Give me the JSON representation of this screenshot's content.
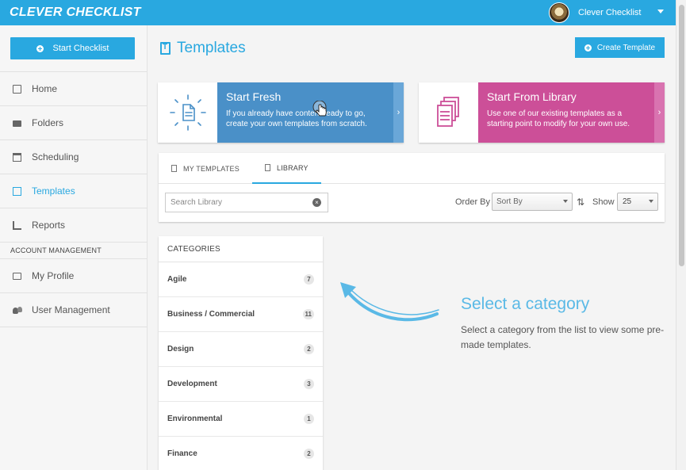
{
  "app": {
    "logo": "CLEVER CHECKLIST",
    "user_name": "Clever Checklist"
  },
  "sidebar": {
    "start_button": "Start Checklist",
    "items": [
      {
        "label": "Home",
        "icon": "document-icon"
      },
      {
        "label": "Folders",
        "icon": "folder-icon"
      },
      {
        "label": "Scheduling",
        "icon": "calendar-icon"
      },
      {
        "label": "Templates",
        "icon": "template-icon",
        "active": true
      },
      {
        "label": "Reports",
        "icon": "chart-icon"
      }
    ],
    "section_label": "ACCOUNT MANAGEMENT",
    "account_items": [
      {
        "label": "My Profile",
        "icon": "id-card-icon"
      },
      {
        "label": "User Management",
        "icon": "users-icon"
      }
    ]
  },
  "main": {
    "title": "Templates",
    "create_button": "Create Template",
    "cards": {
      "fresh": {
        "title": "Start Fresh",
        "description": "If you already have content ready to go, create your own templates from scratch."
      },
      "library": {
        "title": "Start From Library",
        "description": "Use one of our existing templates as a starting point to modify for your own use."
      }
    },
    "tabs": {
      "my_templates": "MY TEMPLATES",
      "library": "LIBRARY"
    },
    "search": {
      "placeholder": "Search Library"
    },
    "order_by_label": "Order By",
    "sort_select_value": "Sort By",
    "show_label": "Show",
    "show_select_value": "25",
    "categories": {
      "header": "CATEGORIES",
      "items": [
        {
          "name": "Agile",
          "count": "7"
        },
        {
          "name": "Business / Commercial",
          "count": "11"
        },
        {
          "name": "Design",
          "count": "2"
        },
        {
          "name": "Development",
          "count": "3"
        },
        {
          "name": "Environmental",
          "count": "1"
        },
        {
          "name": "Finance",
          "count": "2"
        }
      ]
    },
    "hint": {
      "title": "Select a category",
      "text": "Select a category from the list to view some pre-made templates."
    }
  },
  "colors": {
    "brand_blue": "#29a8e0",
    "fresh_card": "#4a90c8",
    "library_card": "#cc4f98"
  }
}
